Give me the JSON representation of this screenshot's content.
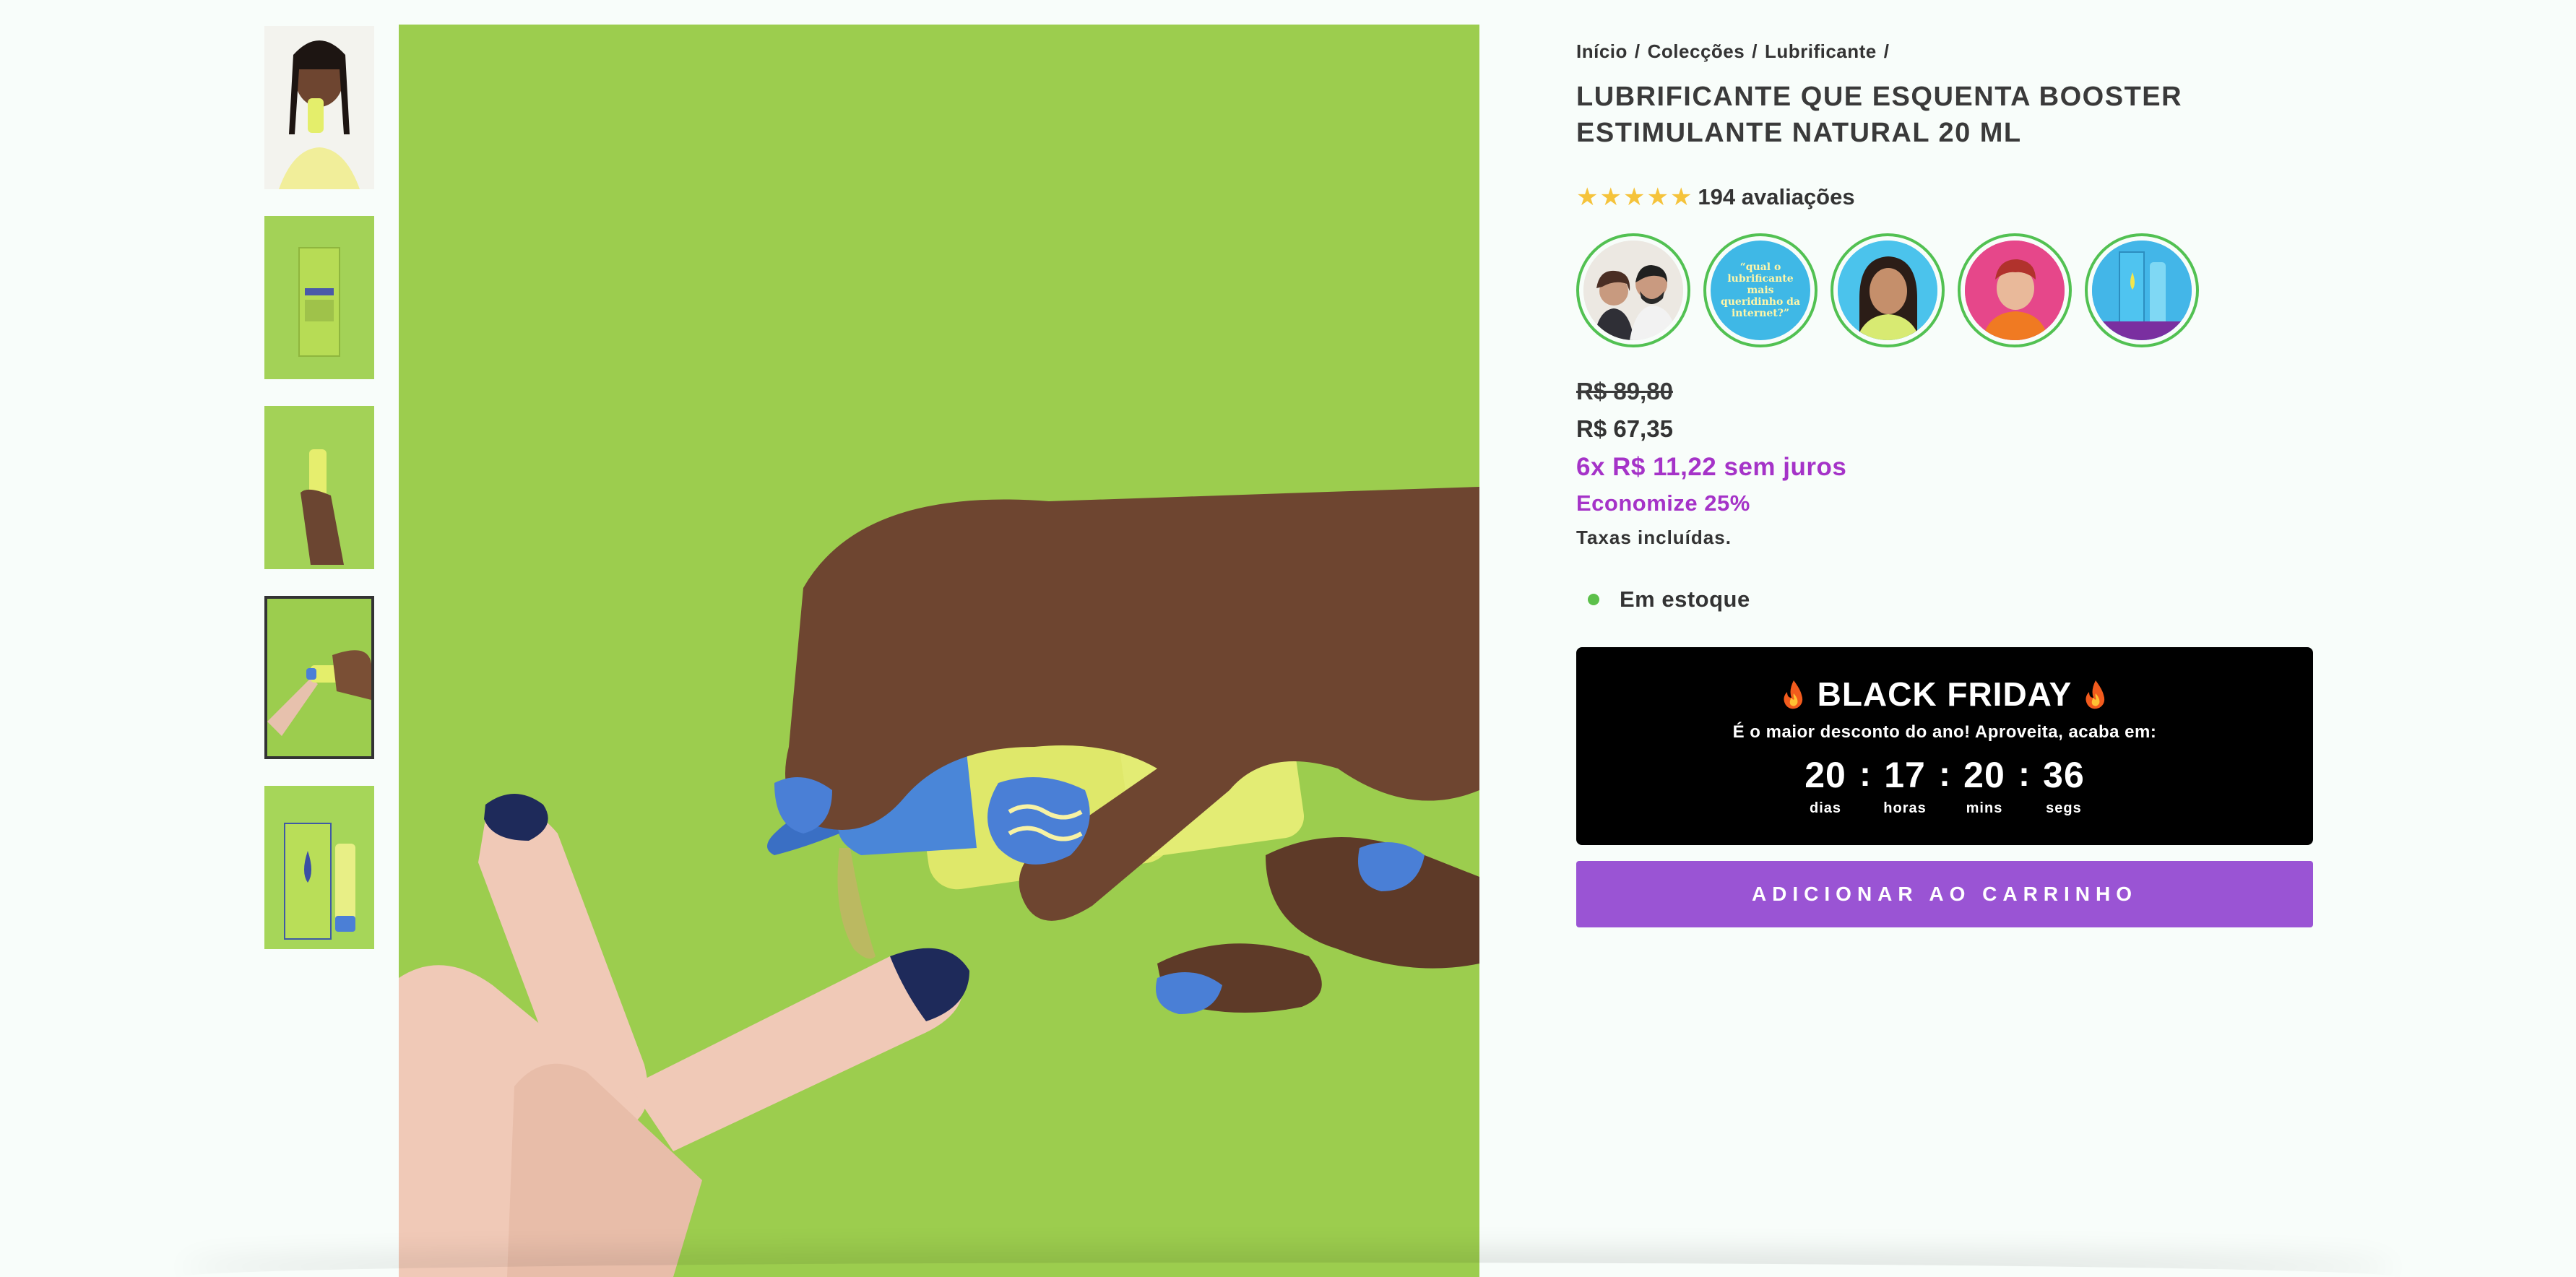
{
  "breadcrumb": {
    "items": [
      "Início",
      "Colecções",
      "Lubrificante"
    ],
    "separator": "/"
  },
  "product": {
    "title": "LUBRIFICANTE QUE ESQUENTA BOOSTER ESTIMULANTE NATURAL 20 ML",
    "rating_stars": 5,
    "reviews_text": "194 avaliações",
    "stories": [
      {
        "name": "story-couple",
        "text": ""
      },
      {
        "name": "story-quote",
        "text": "“qual o lubrificante mais queridinho da internet?”"
      },
      {
        "name": "story-woman",
        "text": ""
      },
      {
        "name": "story-man",
        "text": ""
      },
      {
        "name": "story-product",
        "text": ""
      }
    ],
    "price_old": "R$ 89,80",
    "price_new": "R$ 67,35",
    "installments": "6x R$ 11,22 sem juros",
    "economize": "Economize 25%",
    "taxes": "Taxas incluídas.",
    "stock": "Em estoque"
  },
  "black_friday": {
    "title": "BLACK FRIDAY",
    "subtitle": "É o maior desconto do ano! Aproveita, acaba em:",
    "countdown": [
      {
        "value": "20",
        "label": "dias"
      },
      {
        "value": "17",
        "label": "horas"
      },
      {
        "value": "20",
        "label": "mins"
      },
      {
        "value": "36",
        "label": "segs"
      }
    ],
    "separator": ":"
  },
  "cart_button": "ADICIONAR AO CARRINHO",
  "gallery": {
    "thumbnails": [
      "thumb-model",
      "thumb-box",
      "thumb-hand-tube",
      "thumb-applying",
      "thumb-box-and-tube"
    ],
    "active_index": 3
  },
  "colors": {
    "accent_purple": "#9a54d4",
    "price_purple": "#a533c8",
    "star_yellow": "#f5c33b",
    "stock_green": "#5cc04a",
    "image_green": "#9ccd4e"
  }
}
